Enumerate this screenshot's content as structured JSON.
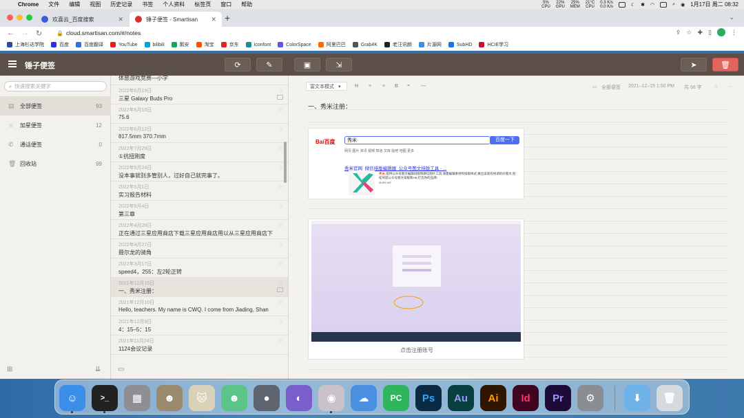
{
  "menubar": {
    "app": "Chrome",
    "items": [
      "文件",
      "编辑",
      "视图",
      "历史记录",
      "书签",
      "个人资料",
      "标签页",
      "窗口",
      "帮助"
    ],
    "cpu": "5%",
    "cpu_label": "CPU",
    "gpu": "22%",
    "gpu_label": "GPU",
    "mem": "25%",
    "mem_label": "MEM",
    "temp": "21°C",
    "temp_label": "CPU",
    "net_up": "0.3 K/s",
    "net_down": "0.0 K/s",
    "datetime": "1月17日 周二 08:32"
  },
  "tabs": [
    {
      "title": "欢喜云_百度搜索",
      "favicon_color": "#3b5bdb",
      "active": false
    },
    {
      "title": "锤子便签 - Smartisan",
      "favicon_color": "#d9302c",
      "active": true
    }
  ],
  "address": {
    "url": "cloud.smartisan.com/#/notes"
  },
  "bookmarks": [
    {
      "label": "上海杉达学院",
      "color": "#2b4d9c"
    },
    {
      "label": "百度",
      "color": "#2932e1"
    },
    {
      "label": "百度翻译",
      "color": "#2f6fde"
    },
    {
      "label": "YouTube",
      "color": "#e62117"
    },
    {
      "label": "bilibili",
      "color": "#00a1d6"
    },
    {
      "label": "鹅安",
      "color": "#13a85c"
    },
    {
      "label": "淘宝",
      "color": "#ff5000"
    },
    {
      "label": "京东",
      "color": "#e1251b"
    },
    {
      "label": "iconfont",
      "color": "#1e8e8e"
    },
    {
      "label": "ColorSpace",
      "color": "#5b5bd6"
    },
    {
      "label": "阿里巴巴",
      "color": "#ff6a00"
    },
    {
      "label": "Grab4K",
      "color": "#555555"
    },
    {
      "label": "老汪讯朗",
      "color": "#222222"
    },
    {
      "label": "片源网",
      "color": "#3a8ee6"
    },
    {
      "label": "SubHD",
      "color": "#1a73e8"
    },
    {
      "label": "HCIE学习",
      "color": "#c8102e"
    }
  ],
  "app": {
    "title": "锤子便签"
  },
  "sidebar": {
    "search_placeholder": "快速搜索关键字",
    "items": [
      {
        "label": "全部便签",
        "count": "93",
        "icon": "note-icon",
        "selected": true
      },
      {
        "label": "加星便签",
        "count": "12",
        "icon": "star-icon",
        "selected": false
      },
      {
        "label": "通话便签",
        "count": "0",
        "icon": "phone-icon",
        "selected": false
      },
      {
        "label": "回收站",
        "count": "99",
        "icon": "trash-icon",
        "selected": false
      }
    ]
  },
  "notes": [
    {
      "date": "",
      "title": "体感游戏竞赛—小学",
      "has_image": false,
      "selected": false
    },
    {
      "date": "2022年6月19日",
      "title": "三星 Galaxy Buds Pro",
      "has_image": true,
      "selected": false
    },
    {
      "date": "2022年6月10日",
      "title": "75.6",
      "has_image": false,
      "selected": false
    },
    {
      "date": "2022年6月12日",
      "title": "817.5mm    370.7mm",
      "has_image": false,
      "selected": false
    },
    {
      "date": "2022年7月29日",
      "title": "①抗扭刚度",
      "has_image": false,
      "selected": false
    },
    {
      "date": "2022年5月24日",
      "title": "没本事就别多管别人，过好自己就完事了。",
      "has_image": false,
      "selected": false
    },
    {
      "date": "2022年5月1日",
      "title": "实习报告材料",
      "has_image": false,
      "selected": false
    },
    {
      "date": "2022年5月4日",
      "title": "第三章",
      "has_image": false,
      "selected": false
    },
    {
      "date": "2022年4月28日",
      "title": "正在通过三星应用商店下载三星应用商店用以从三星应用商店下",
      "has_image": false,
      "selected": false
    },
    {
      "date": "2022年4月27日",
      "title": "聂尔龙的骑角",
      "has_image": false,
      "selected": false
    },
    {
      "date": "2022年3月17日",
      "title": "speed4，255：左2轮正转",
      "has_image": false,
      "selected": false
    },
    {
      "date": "2021年12月15日",
      "title": "一、秀米注册：",
      "has_image": true,
      "selected": true
    },
    {
      "date": "2021年12月10日",
      "title": "Hello, teachers. My name is CWQ. I come from Jiading, Shan",
      "has_image": false,
      "selected": false
    },
    {
      "date": "2021年12月9日",
      "title": "4：15–5：15",
      "has_image": false,
      "selected": false
    },
    {
      "date": "2021年11月24日",
      "title": "1124会议记录",
      "has_image": false,
      "selected": false
    }
  ],
  "editor": {
    "mode": "富文本模式",
    "format_buttons": [
      "H",
      "≡",
      "≡",
      "B",
      "❞",
      "—"
    ],
    "category": "全部便签",
    "timestamp": "2021–12–15 1:50 PM",
    "word_count": "共 66 字",
    "heading": "一、秀米注册：",
    "caption": "点击注册账号"
  },
  "baidu": {
    "logo_a": "Bai",
    "logo_b": "百度",
    "query": "秀米",
    "button": "百度一下",
    "tabs": "网页  图片  资讯  视频  知道  文库  贴吧  地图  更多",
    "result_title": "秀米官网_微信排版编辑器_公众号图文排版工具 - ...",
    "desc_red": "秀米,",
    "desc": "提供公众号图文编辑排版和微信图片工具,海量编辑素材和排版样式,做出美观有格调的好图文,轻松驾驭公众号图文排版和H5,打造你的品牌!",
    "site": "xiumi.us/"
  },
  "dock": [
    {
      "name": "finder-icon",
      "color": "#3b8fe8",
      "glyph": "☺"
    },
    {
      "name": "terminal-icon",
      "color": "#222222",
      "glyph": ">_"
    },
    {
      "name": "launchpad-icon",
      "color": "#8e8e93",
      "glyph": "▦"
    },
    {
      "name": "character-icon",
      "color": "#9c8a6e",
      "glyph": "☻"
    },
    {
      "name": "cat-game-icon",
      "color": "#d9d2b8",
      "glyph": "🐱"
    },
    {
      "name": "android-icon",
      "color": "#5cc489",
      "glyph": "☻"
    },
    {
      "name": "bomb-icon",
      "color": "#5e6470",
      "glyph": "●"
    },
    {
      "name": "planet-icon",
      "color": "#7a5ec9",
      "glyph": "◐"
    },
    {
      "name": "chrome-icon",
      "color": "#c9c3c9",
      "glyph": "◉"
    },
    {
      "name": "cloud-icon",
      "color": "#4a8fe0",
      "glyph": "☁"
    },
    {
      "name": "pycharm-icon",
      "color": "#2fb55d",
      "glyph": "PC"
    },
    {
      "name": "photoshop-icon",
      "color": "#0b2a44",
      "glyph": "Ps"
    },
    {
      "name": "audition-icon",
      "color": "#07403f",
      "glyph": "Au"
    },
    {
      "name": "illustrator-icon",
      "color": "#2e1600",
      "glyph": "Ai"
    },
    {
      "name": "indesign-icon",
      "color": "#3e0420",
      "glyph": "Id"
    },
    {
      "name": "premiere-icon",
      "color": "#1e0b3a",
      "glyph": "Pr"
    },
    {
      "name": "system-preferences-icon",
      "color": "#8a8d92",
      "glyph": "⚙"
    },
    {
      "name": "downloads-folder-icon",
      "color": "#6fb2e8",
      "glyph": "⬇"
    },
    {
      "name": "dock-trash-icon",
      "color": "#d7dadd",
      "glyph": "🗑"
    }
  ]
}
